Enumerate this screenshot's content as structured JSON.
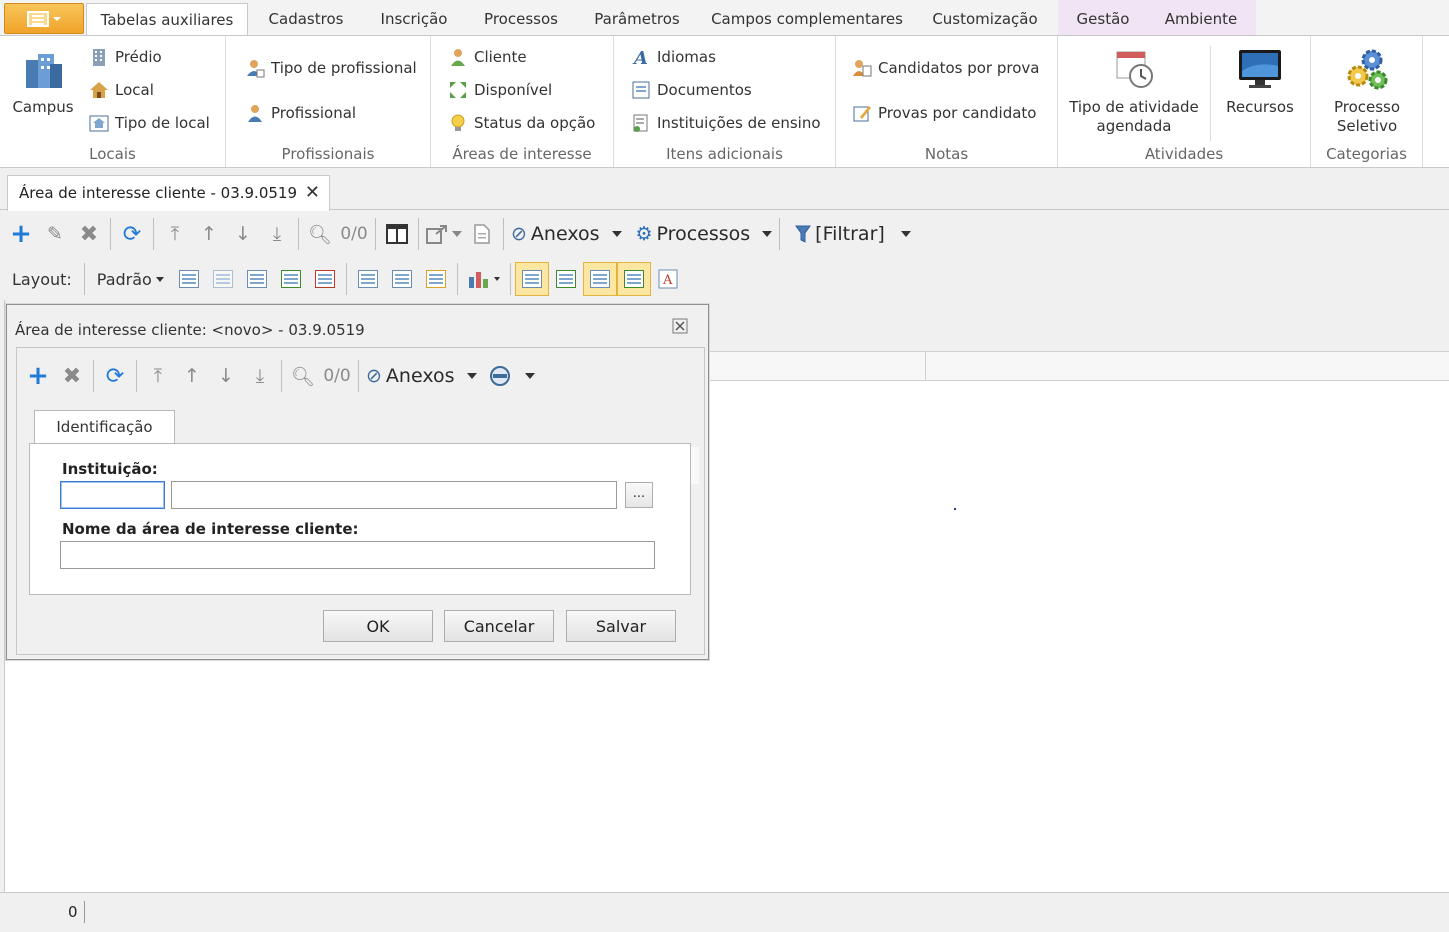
{
  "ribbon_tabs": [
    "Tabelas auxiliares",
    "Cadastros",
    "Inscrição",
    "Processos",
    "Parâmetros",
    "Campos complementares",
    "Customização",
    "Gestão",
    "Ambiente"
  ],
  "ribbon": {
    "locais": {
      "caption": "Locais",
      "campus": "Campus",
      "predio": "Prédio",
      "local": "Local",
      "tipo_local": "Tipo de local"
    },
    "profissionais": {
      "caption": "Profissionais",
      "tipo_profissional": "Tipo de profissional",
      "profissional": "Profissional"
    },
    "areas": {
      "caption": "Áreas de interesse",
      "cliente": "Cliente",
      "disponivel": "Disponível",
      "status_opcao": "Status da opção"
    },
    "itens": {
      "caption": "Itens adicionais",
      "idiomas": "Idiomas",
      "documentos": "Documentos",
      "instituicoes": "Instituições de ensino"
    },
    "notas": {
      "caption": "Notas",
      "candidatos": "Candidatos por prova",
      "provas": "Provas por candidato"
    },
    "atividades": {
      "caption": "Atividades",
      "tipo_atividade_1": "Tipo de atividade",
      "tipo_atividade_2": "agendada",
      "recursos": "Recursos"
    },
    "categorias": {
      "caption": "Categorias",
      "processo_1": "Processo",
      "processo_2": "Seletivo"
    }
  },
  "doc_tab": {
    "title": "Área de interesse cliente - 03.9.0519",
    "close": "✕"
  },
  "main_toolbar": {
    "counter": "0/0",
    "anexos": "Anexos",
    "processos": "Processos",
    "filtrar": "[Filtrar]"
  },
  "layout_bar": {
    "label": "Layout:",
    "value": "Padrão"
  },
  "status": {
    "count": "0"
  },
  "dialog": {
    "title": "Área de interesse cliente: <novo> - 03.9.0519",
    "counter": "0/0",
    "anexos": "Anexos",
    "tab": "Identificação",
    "instituicao_label": "Instituição:",
    "instituicao_code": "",
    "instituicao_name": "",
    "ellipsis": "...",
    "nome_label": "Nome da área de interesse cliente:",
    "nome_value": "",
    "ok": "OK",
    "cancel": "Cancelar",
    "save": "Salvar"
  }
}
